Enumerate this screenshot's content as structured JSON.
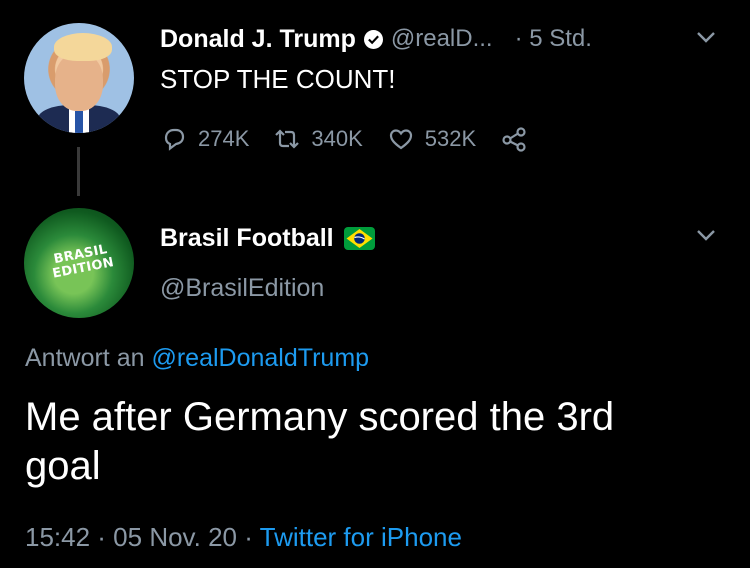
{
  "tweet": {
    "author_name": "Donald J. Trump",
    "handle": "@realD...",
    "time": "· 5 Std.",
    "text": "STOP THE COUNT!",
    "replies": "274K",
    "retweets": "340K",
    "likes": "532K"
  },
  "reply": {
    "author_name": "Brasil Football",
    "handle": "@BrasilEdition",
    "reply_to_label": "Antwort an",
    "reply_to_handle": "@realDonaldTrump",
    "text_line1": "Me after Germany scored the 3rd",
    "text_line2": "goal",
    "timestamp": "15:42 · 05 Nov. 20 ·",
    "client": "Twitter for iPhone"
  },
  "avatar_logo_text": "BRASIL EDITION",
  "colors": {
    "background": "#000000",
    "secondary_text": "#8b98a5",
    "link": "#1d9bf0",
    "brazil_green": "#009c3b",
    "brazil_yellow": "#ffdf00",
    "brazil_blue": "#002776"
  },
  "icons": [
    "verified-badge-icon",
    "chevron-down-icon",
    "reply-icon",
    "retweet-icon",
    "like-icon",
    "share-icon",
    "brazil-flag-icon"
  ]
}
